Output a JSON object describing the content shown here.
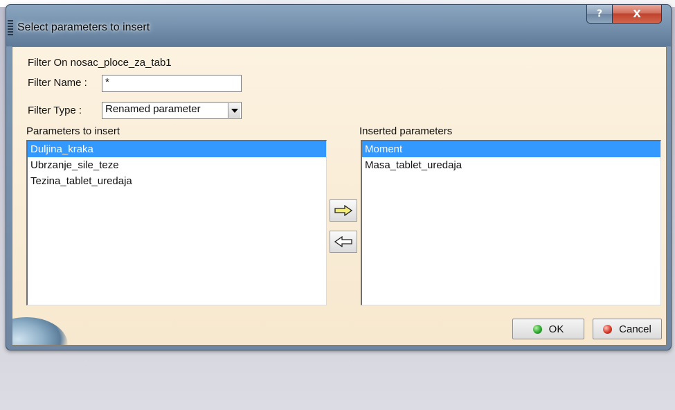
{
  "window": {
    "title": "Select parameters to insert",
    "help_glyph": "?",
    "close_glyph": "X"
  },
  "filter": {
    "on_label": "Filter On nosac_ploce_za_tab1",
    "name_label": "Filter Name :",
    "name_value": "*",
    "type_label": "Filter Type :",
    "type_value": "Renamed parameter"
  },
  "left_list": {
    "header": "Parameters to insert",
    "items": [
      "Duljina_kraka",
      "Ubrzanje_sile_teze",
      "Tezina_tablet_uredaja"
    ],
    "selected_index": 0
  },
  "right_list": {
    "header": "Inserted parameters",
    "items": [
      "Moment",
      "Masa_tablet_uredaja"
    ],
    "selected_index": 0
  },
  "buttons": {
    "ok": "OK",
    "cancel": "Cancel"
  },
  "icons": {
    "move_right": "arrow-right-icon",
    "move_left": "arrow-left-icon",
    "ok": "green-dot-icon",
    "cancel": "red-dot-icon"
  },
  "colors": {
    "selection": "#3399ff",
    "dialog_bg": "#fcf2e0",
    "ok_icon": "#2ea82e",
    "cancel_icon": "#d63a2a"
  }
}
